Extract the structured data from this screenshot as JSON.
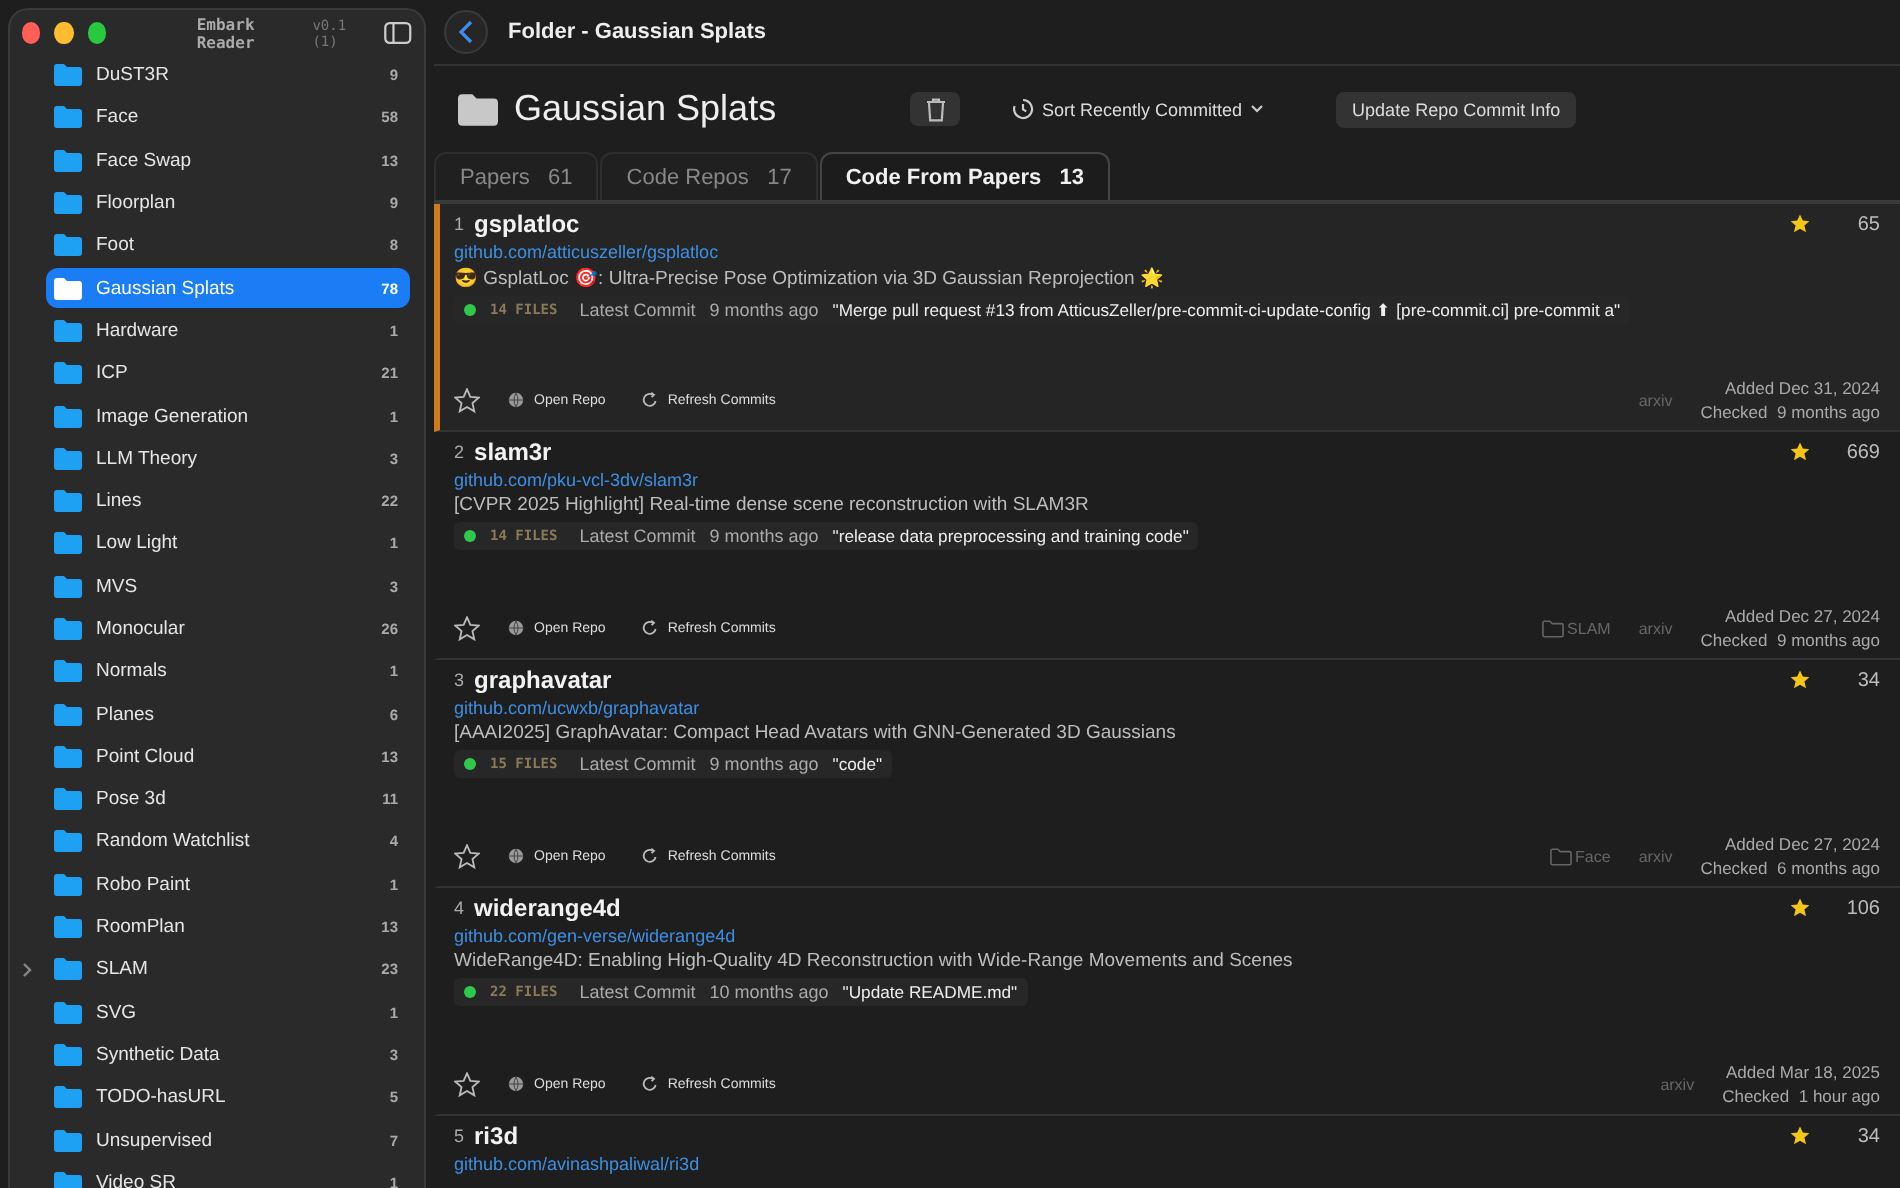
{
  "window": {
    "app_title": "Embark Reader",
    "version": "v0.1 (1)"
  },
  "sidebar": {
    "items": [
      {
        "name": "DuST3R",
        "count": "9",
        "selected": false,
        "expandable": false
      },
      {
        "name": "Face",
        "count": "58",
        "selected": false,
        "expandable": false
      },
      {
        "name": "Face Swap",
        "count": "13",
        "selected": false,
        "expandable": false
      },
      {
        "name": "Floorplan",
        "count": "9",
        "selected": false,
        "expandable": false
      },
      {
        "name": "Foot",
        "count": "8",
        "selected": false,
        "expandable": false
      },
      {
        "name": "Gaussian Splats",
        "count": "78",
        "selected": true,
        "expandable": false
      },
      {
        "name": "Hardware",
        "count": "1",
        "selected": false,
        "expandable": false
      },
      {
        "name": "ICP",
        "count": "21",
        "selected": false,
        "expandable": false
      },
      {
        "name": "Image Generation",
        "count": "1",
        "selected": false,
        "expandable": false
      },
      {
        "name": "LLM Theory",
        "count": "3",
        "selected": false,
        "expandable": false
      },
      {
        "name": "Lines",
        "count": "22",
        "selected": false,
        "expandable": false
      },
      {
        "name": "Low Light",
        "count": "1",
        "selected": false,
        "expandable": false
      },
      {
        "name": "MVS",
        "count": "3",
        "selected": false,
        "expandable": false
      },
      {
        "name": "Monocular",
        "count": "26",
        "selected": false,
        "expandable": false
      },
      {
        "name": "Normals",
        "count": "1",
        "selected": false,
        "expandable": false
      },
      {
        "name": "Planes",
        "count": "6",
        "selected": false,
        "expandable": false
      },
      {
        "name": "Point Cloud",
        "count": "13",
        "selected": false,
        "expandable": false
      },
      {
        "name": "Pose 3d",
        "count": "11",
        "selected": false,
        "expandable": false
      },
      {
        "name": "Random Watchlist",
        "count": "4",
        "selected": false,
        "expandable": false
      },
      {
        "name": "Robo Paint",
        "count": "1",
        "selected": false,
        "expandable": false
      },
      {
        "name": "RoomPlan",
        "count": "13",
        "selected": false,
        "expandable": false
      },
      {
        "name": "SLAM",
        "count": "23",
        "selected": false,
        "expandable": true
      },
      {
        "name": "SVG",
        "count": "1",
        "selected": false,
        "expandable": false
      },
      {
        "name": "Synthetic Data",
        "count": "3",
        "selected": false,
        "expandable": false
      },
      {
        "name": "TODO-hasURL",
        "count": "5",
        "selected": false,
        "expandable": false
      },
      {
        "name": "Unsupervised",
        "count": "7",
        "selected": false,
        "expandable": false
      },
      {
        "name": "Video SR",
        "count": "1",
        "selected": false,
        "expandable": false
      }
    ]
  },
  "toolbar": {
    "title": "Folder - Gaussian Splats"
  },
  "header": {
    "folder_name": "Gaussian Splats",
    "sort": "Sort Recently Committed",
    "update_button": "Update Repo Commit Info"
  },
  "tabs": [
    {
      "label": "Papers",
      "count": "61",
      "selected": false
    },
    {
      "label": "Code Repos",
      "count": "17",
      "selected": false
    },
    {
      "label": "Code From Papers",
      "count": "13",
      "selected": true
    }
  ],
  "repos": [
    {
      "index": "1",
      "name": "gsplatloc",
      "url": "github.com/atticuszeller/gsplatloc",
      "description": "😎 GsplatLoc 🎯: Ultra-Precise Pose Optimization via 3D Gaussian Reprojection 🌟",
      "files": "14 FILES",
      "commit_label": "Latest Commit",
      "commit_time": "9 months ago",
      "commit_message": "\"Merge pull request #13 from AtticusZeller/pre-commit-ci-update-config ⬆ [pre-commit.ci] pre-commit a\"",
      "stars": "65",
      "selected": true,
      "open_label": "Open Repo",
      "refresh_label": "Refresh Commits",
      "source": "arxiv",
      "added": "Added Dec 31, 2024",
      "checked_label": "Checked",
      "checked": "9 months ago"
    },
    {
      "index": "2",
      "name": "slam3r",
      "url": "github.com/pku-vcl-3dv/slam3r",
      "description": "[CVPR 2025 Highlight] Real-time dense scene reconstruction with SLAM3R",
      "files": "14 FILES",
      "commit_label": "Latest Commit",
      "commit_time": "9 months ago",
      "commit_message": "\"release data preprocessing and training code\"",
      "stars": "669",
      "selected": false,
      "open_label": "Open Repo",
      "refresh_label": "Refresh Commits",
      "folder": "SLAM",
      "source": "arxiv",
      "added": "Added Dec 27, 2024",
      "checked_label": "Checked",
      "checked": "9 months ago"
    },
    {
      "index": "3",
      "name": "graphavatar",
      "url": "github.com/ucwxb/graphavatar",
      "description": "[AAAI2025] GraphAvatar: Compact Head Avatars with GNN-Generated 3D Gaussians",
      "files": "15 FILES",
      "commit_label": "Latest Commit",
      "commit_time": "9 months ago",
      "commit_message": "\"code\"",
      "stars": "34",
      "selected": false,
      "open_label": "Open Repo",
      "refresh_label": "Refresh Commits",
      "folder": "Face",
      "source": "arxiv",
      "added": "Added Dec 27, 2024",
      "checked_label": "Checked",
      "checked": "6 months ago"
    },
    {
      "index": "4",
      "name": "widerange4d",
      "url": "github.com/gen-verse/widerange4d",
      "description": "WideRange4D: Enabling High-Quality 4D Reconstruction with Wide-Range Movements and Scenes",
      "files": "22 FILES",
      "commit_label": "Latest Commit",
      "commit_time": "10 months ago",
      "commit_message": "\"Update README.md\"",
      "stars": "106",
      "selected": false,
      "open_label": "Open Repo",
      "refresh_label": "Refresh Commits",
      "source": "arxiv",
      "added": "Added Mar 18, 2025",
      "checked_label": "Checked",
      "checked": "1 hour ago"
    },
    {
      "index": "5",
      "name": "ri3d",
      "url": "github.com/avinashpaliwal/ri3d",
      "stars": "34",
      "selected": false
    }
  ]
}
